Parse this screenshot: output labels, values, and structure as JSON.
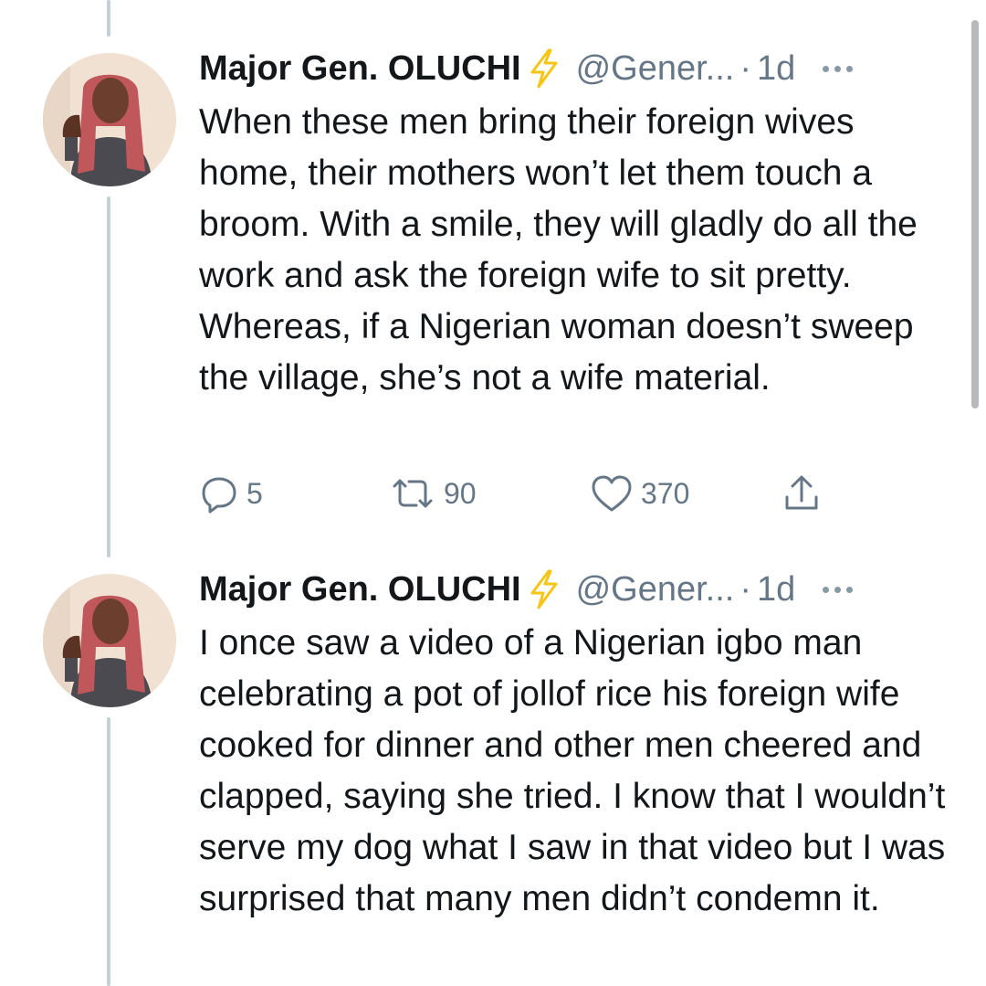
{
  "tweets": [
    {
      "name": "Major Gen. OLUCHI",
      "badge_icon": "lightning-bolt-icon",
      "handle": "@Gener...",
      "separator": "·",
      "time": "1d",
      "text": "When these men bring their foreign wives home, their mothers won’t let them touch a broom. With a smile, they will gladly do all the work and ask the foreign wife to sit pretty. Whereas, if a Nigerian woman doesn’t sweep the village, she’s not a wife material.",
      "replies": "5",
      "retweets": "90",
      "likes": "370"
    },
    {
      "name": "Major Gen. OLUCHI",
      "badge_icon": "lightning-bolt-icon",
      "handle": "@Gener...",
      "separator": "·",
      "time": "1d",
      "text": "I once saw a video of a Nigerian igbo man celebrating a pot of jollof rice his foreign wife cooked for dinner and other men cheered and clapped, saying she tried. I know that I wouldn’t serve my dog what I saw in that video but I was surprised that many men didn’t condemn it."
    }
  ],
  "colors": {
    "text": "#14171a",
    "secondary": "#657786",
    "thread_line": "#c4cfd6",
    "badge": "#f5c518"
  }
}
